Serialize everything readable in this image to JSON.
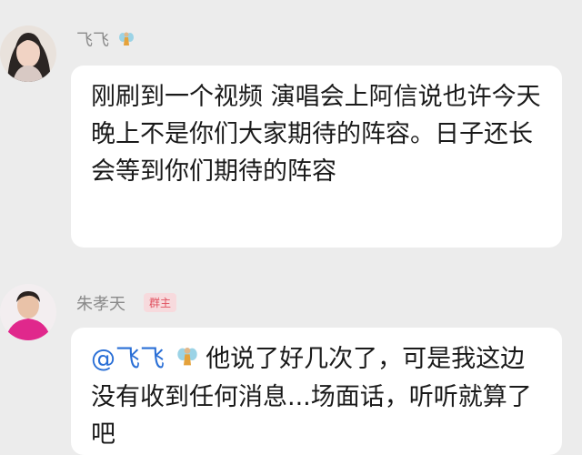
{
  "messages": [
    {
      "sender": "飞飞",
      "badge": "",
      "text": "刚刷到一个视频 演唱会上阿信说也许今天晚上不是你们大家期待的阵容。日子还长 会等到你们期待的阵容",
      "mention": ""
    },
    {
      "sender": "朱孝天",
      "badge": "群主",
      "mention": "@飞飞",
      "text": " 他说了好几次了，可是我这边没有收到任何消息...场面话，听听就算了吧"
    }
  ]
}
